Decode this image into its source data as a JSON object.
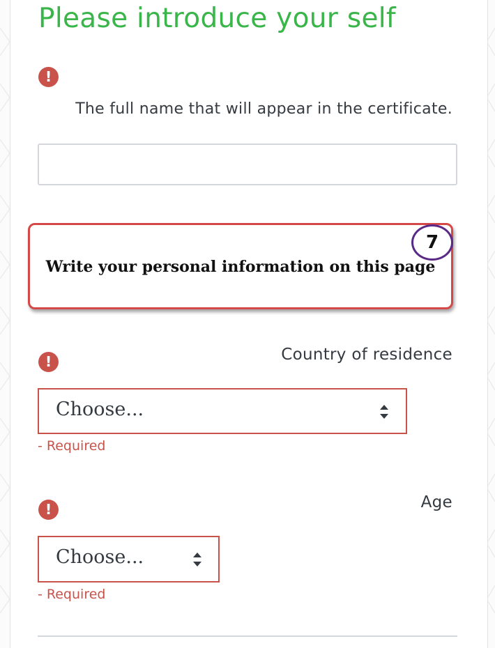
{
  "form": {
    "title": "Please introduce your self",
    "required_icon": "exclamation-circle-icon",
    "full_name": {
      "label": "The full name that will appear in the certificate.",
      "value": "",
      "placeholder": ""
    },
    "callout": {
      "text": "Write your personal information on this page",
      "step_number": "7"
    },
    "country": {
      "label": "Country of residence",
      "selected": "Choose...",
      "error": "- Required"
    },
    "age": {
      "label": "Age",
      "selected": "Choose...",
      "error": "- Required"
    }
  },
  "colors": {
    "title_green": "#39b54a",
    "required_red": "#c9524a",
    "callout_border": "#d44848",
    "badge_purple": "#5b2a86",
    "text_dark": "#343a40"
  }
}
